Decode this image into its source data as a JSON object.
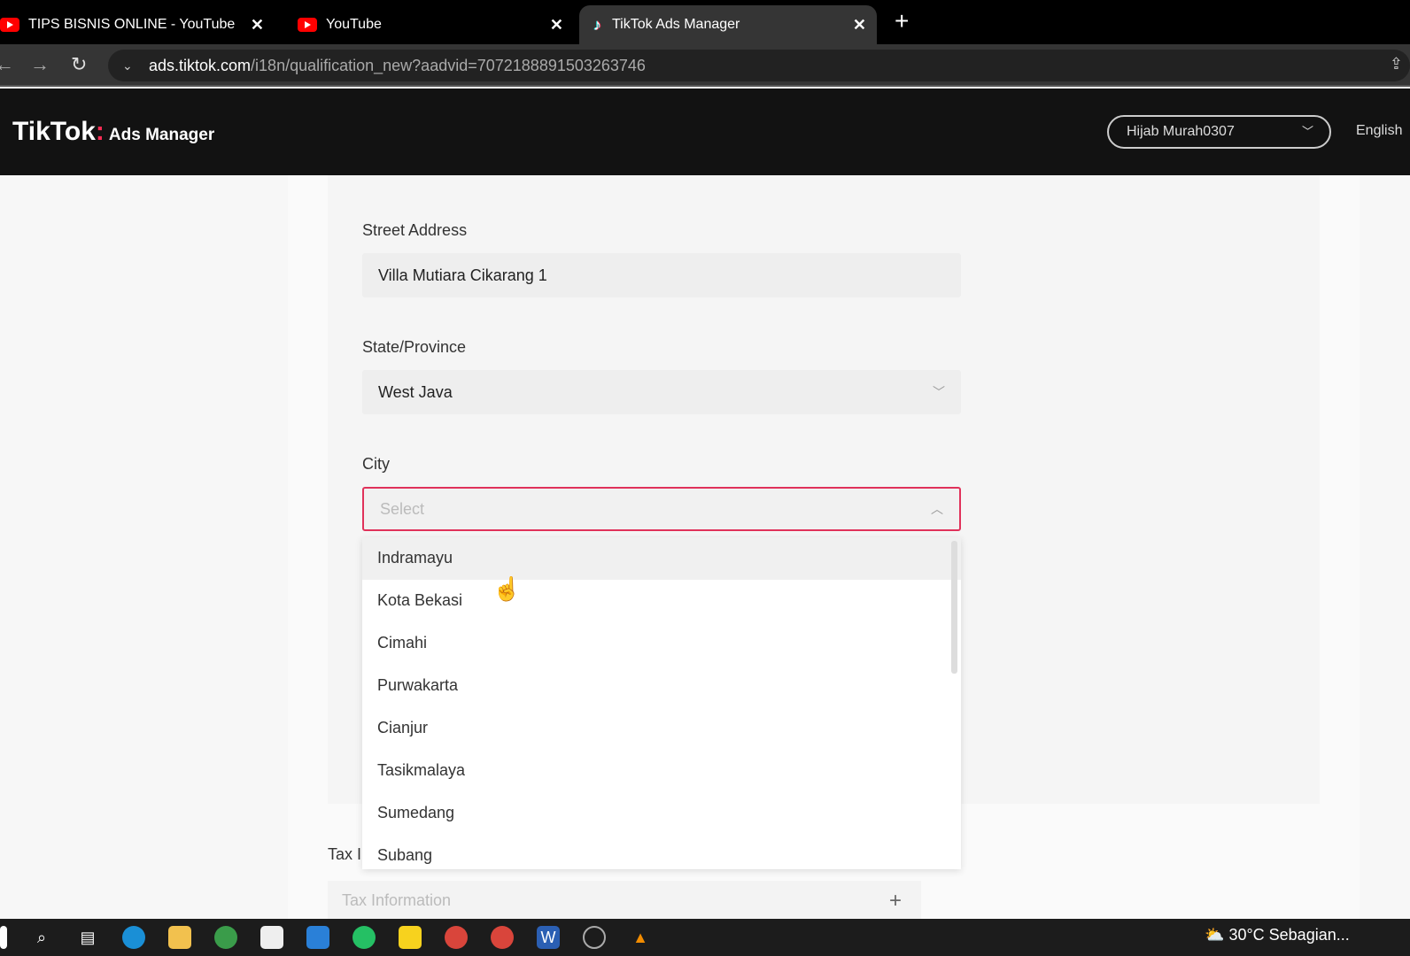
{
  "browser": {
    "tabs": [
      {
        "title": "TIPS BISNIS ONLINE - YouTube",
        "icon": "youtube-icon"
      },
      {
        "title": "YouTube",
        "icon": "youtube-icon"
      },
      {
        "title": "TikTok Ads Manager",
        "icon": "tiktok-icon",
        "active": true
      }
    ],
    "close_glyph": "✕",
    "new_tab_glyph": "+",
    "url_domain": "ads.tiktok.com",
    "url_path": "/i18n/qualification_new?aadvid=7072188891503263746"
  },
  "header": {
    "logo": "TikTok",
    "logo_sub": "Ads Manager",
    "account": "Hijab Murah0307",
    "language": "English"
  },
  "form": {
    "street_label": "Street Address",
    "street_value": "Villa Mutiara Cikarang 1",
    "state_label": "State/Province",
    "state_value": "West Java",
    "city_label": "City",
    "city_placeholder": "Select",
    "city_options": [
      "Indramayu",
      "Kota Bekasi",
      "Cimahi",
      "Purwakarta",
      "Cianjur",
      "Tasikmalaya",
      "Sumedang",
      "Subang"
    ],
    "tax_label": "Tax I",
    "tax_placeholder": "Tax Information",
    "tax_add": "+"
  },
  "taskbar": {
    "weather": "30°C  Sebagian..."
  },
  "colors": {
    "accent": "#e0325a",
    "header_bg": "#121212"
  }
}
